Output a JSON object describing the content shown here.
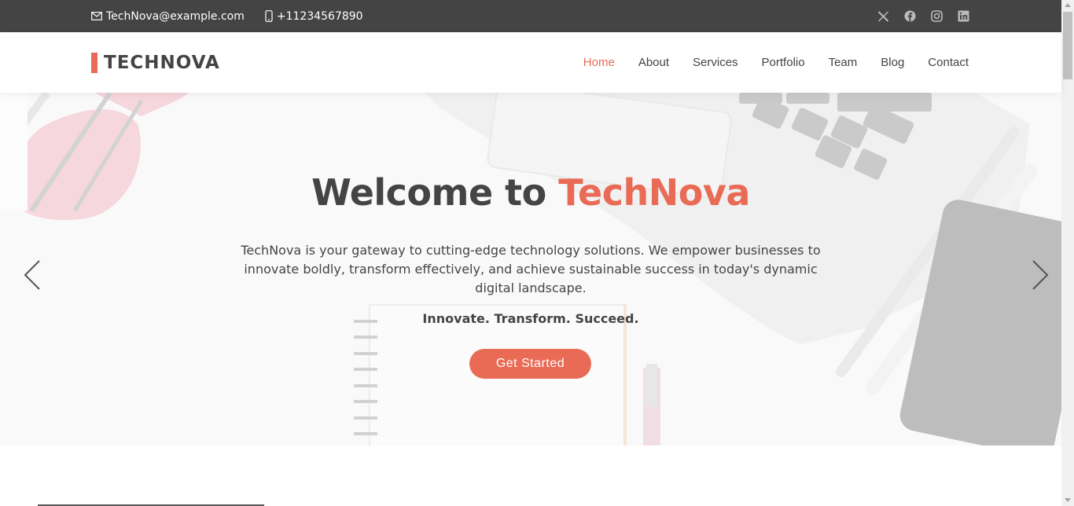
{
  "topbar": {
    "email": "TechNova@example.com",
    "phone": "+11234567890",
    "social": [
      {
        "icon": "x-twitter-icon"
      },
      {
        "icon": "facebook-icon"
      },
      {
        "icon": "instagram-icon"
      },
      {
        "icon": "linkedin-icon"
      }
    ]
  },
  "header": {
    "logo_text": "TECHNOVA",
    "nav": [
      {
        "label": "Home",
        "active": true
      },
      {
        "label": "About",
        "active": false
      },
      {
        "label": "Services",
        "active": false
      },
      {
        "label": "Portfolio",
        "active": false
      },
      {
        "label": "Team",
        "active": false
      },
      {
        "label": "Blog",
        "active": false
      },
      {
        "label": "Contact",
        "active": false
      }
    ]
  },
  "hero": {
    "title_prefix": "Welcome to ",
    "title_accent": "TechNova",
    "description": "TechNova is your gateway to cutting-edge technology solutions. We empower businesses to innovate boldly, transform effectively, and achieve sustainable success in today's dynamic digital landscape.",
    "tagline": "Innovate. Transform. Succeed.",
    "cta_label": "Get Started"
  },
  "colors": {
    "accent": "#e96b56",
    "dark": "#444444",
    "topbar_bg": "#444444"
  }
}
